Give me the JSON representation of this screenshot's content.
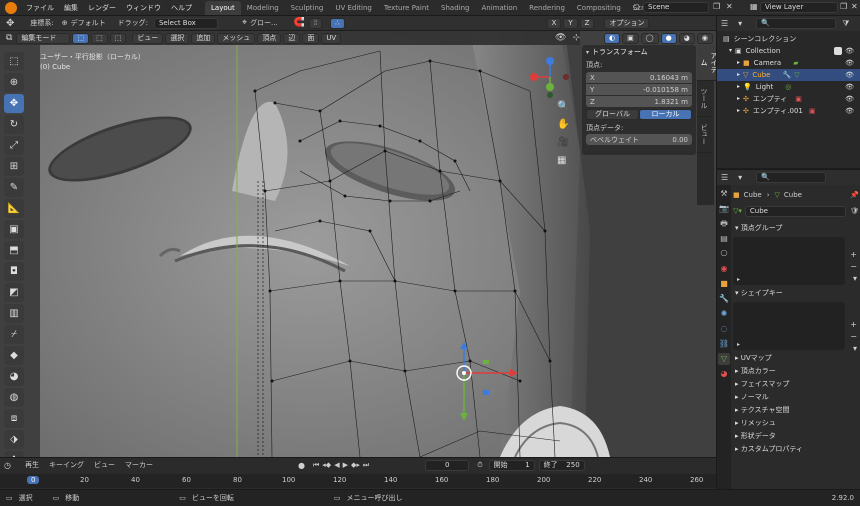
{
  "topbar": {
    "menus": [
      "ファイル",
      "編集",
      "レンダー",
      "ウィンドウ",
      "ヘルプ"
    ],
    "workspaces": [
      "Layout",
      "Modeling",
      "Sculpting",
      "UV Editing",
      "Texture Paint",
      "Shading",
      "Animation",
      "Rendering",
      "Compositing",
      "Scripting"
    ],
    "active_workspace": "Layout",
    "scene": "Scene",
    "view_layer": "View Layer"
  },
  "header": {
    "coord_label": "座標系:",
    "coord_value": "デフォルト",
    "drag_label": "ドラッグ:",
    "drag_value": "Select Box",
    "transform_pivot": "グロー...",
    "options_label": "オプション"
  },
  "viewport_header": {
    "mode": "編集モード",
    "menus": [
      "ビュー",
      "選択",
      "追加",
      "メッシュ",
      "頂点",
      "辺",
      "面",
      "UV"
    ]
  },
  "viewport": {
    "view_name": "ユーザー・平行投影（ローカル）",
    "object_name": "(0) Cube",
    "axes": {
      "x": "X",
      "y": "Y",
      "z": "Z"
    }
  },
  "npanel": {
    "title": "トランスフォーム",
    "vertex_label": "頂点:",
    "x_label": "X",
    "x_value": "0.16043 m",
    "y_label": "Y",
    "y_value": "-0.010158 m",
    "z_label": "Z",
    "z_value": "1.8321 m",
    "global_label": "グローバル",
    "local_label": "ローカル",
    "vertex_data_label": "頂点データ:",
    "bevel_weight_label": "ベベルウェイト",
    "bevel_weight_value": "0.00",
    "tabs": [
      "アイテム",
      "ツール",
      "ビュー"
    ]
  },
  "outliner": {
    "scene_collection": "シーンコレクション",
    "items": [
      {
        "name": "Collection",
        "indent": 1
      },
      {
        "name": "Camera",
        "indent": 2
      },
      {
        "name": "Cube",
        "indent": 2,
        "selected": true
      },
      {
        "name": "Light",
        "indent": 2
      },
      {
        "name": "エンプティ",
        "indent": 2
      },
      {
        "name": "エンプティ.001",
        "indent": 2
      }
    ]
  },
  "properties": {
    "breadcrumb_object": "Cube",
    "breadcrumb_mesh": "Cube",
    "mesh_name": "Cube",
    "sections": [
      "頂点グループ",
      "シェイプキー",
      "UVマップ",
      "頂点カラー",
      "フェイスマップ",
      "ノーマル",
      "テクスチャ空間",
      "リメッシュ",
      "形状データ",
      "カスタムプロパティ"
    ]
  },
  "timeline": {
    "playback": "再生",
    "keying": "キーイング",
    "view": "ビュー",
    "marker": "マーカー",
    "current_frame": "0",
    "start_label": "開始",
    "start_value": "1",
    "end_label": "終了",
    "end_value": "250",
    "ruler": [
      "0",
      "20",
      "40",
      "60",
      "80",
      "100",
      "120",
      "140",
      "160",
      "180",
      "200",
      "220",
      "240",
      "260"
    ]
  },
  "statusbar": {
    "select": "選択",
    "move": "移動",
    "rotate_view": "ビューを回転",
    "context_menu": "メニュー呼び出し",
    "version": "2.92.0"
  },
  "colors": {
    "accent": "#4772b3",
    "x_axis": "#e03c3c",
    "y_axis": "#6bb33c",
    "z_axis": "#3c7be0"
  }
}
